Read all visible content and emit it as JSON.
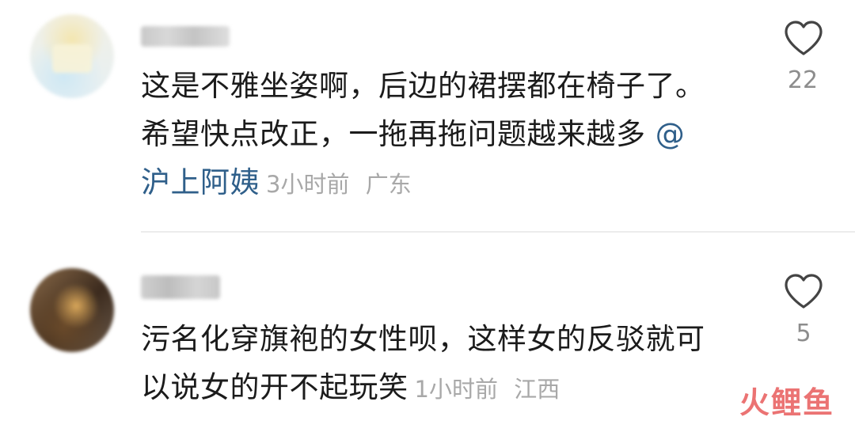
{
  "comments": [
    {
      "text_line1": "这是不雅坐姿啊，后边的裙摆都在椅子了。",
      "text_line2_pre": "希望快点改正，一拖再拖问题越来越多 ",
      "mention_part1": "@",
      "mention_part2": "沪上阿姨",
      "time": "3小时前",
      "location": "广东",
      "likes": "22",
      "icon": "heart-outline-icon"
    },
    {
      "text_line1": "污名化穿旗袍的女性呗，这样女的反驳就可",
      "text_line2_pre": "以说女的开不起玩笑",
      "time": "1小时前",
      "location": "江西",
      "likes": "5",
      "icon": "heart-outline-icon"
    }
  ],
  "watermark": "火鲤鱼",
  "colors": {
    "mention": "#2f5f8a",
    "meta": "#a8a8a8",
    "like_count": "#8d8d8d",
    "watermark": "#e85b5b"
  }
}
